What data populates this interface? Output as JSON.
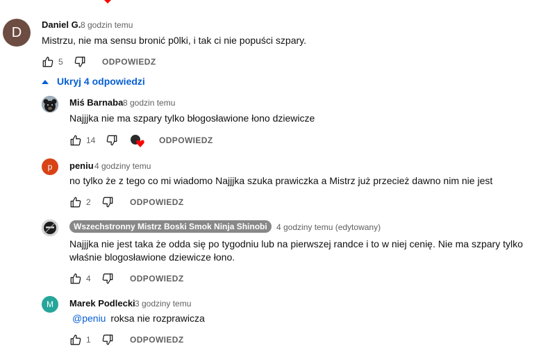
{
  "toggle_label": "Ukryj 4 odpowiedzi",
  "reply_label": "ODPOWIEDZ",
  "colors": {
    "link": "#065fd4",
    "heart": "#ff0000",
    "muted": "#606060",
    "badge": "#888888"
  },
  "main_comment": {
    "avatar_letter": "D",
    "avatar_color": "#6d4c41",
    "author": "Daniel G.",
    "time": "8 godzin temu",
    "text": "Mistrzu, nie ma sensu bronić p0lki, i tak ci nie popuści szpary.",
    "likes": "5"
  },
  "replies": [
    {
      "avatar_icon": "bear-avatar-icon",
      "author": "Miś Barnaba",
      "time": "8 godzin temu",
      "text": "Najjjka nie ma szpary tylko błogosławione łono dziewicze",
      "likes": "14",
      "creator_heart": true
    },
    {
      "avatar_letter": "p",
      "avatar_color": "#d84315",
      "author": "peniu",
      "time": "4 godziny temu",
      "text": "no tylko że z tego co mi wiadomo Najjjka szuka prawiczka a Mistrz już przecież dawno nim nie jest",
      "likes": "2"
    },
    {
      "avatar_icon": "ninja-avatar-icon",
      "author": "Wszechstronny Mistrz Boski Smok Ninja Shinobi",
      "time": "4 godziny temu (edytowany)",
      "text_line1": "Najjjka nie jest taka że odda się po tygodniu lub na pierwszej randce i to w niej cenię. Nie ma szpary tylko",
      "text_line2": "właśnie blogosławione dziewicze łono.",
      "likes": "4"
    },
    {
      "avatar_letter": "M",
      "avatar_color": "#26a69a",
      "author": "Marek Podlecki",
      "time": "3 godziny temu",
      "mention": "@peniu",
      "text": "roksa nie rozprawicza",
      "likes": "1"
    }
  ]
}
